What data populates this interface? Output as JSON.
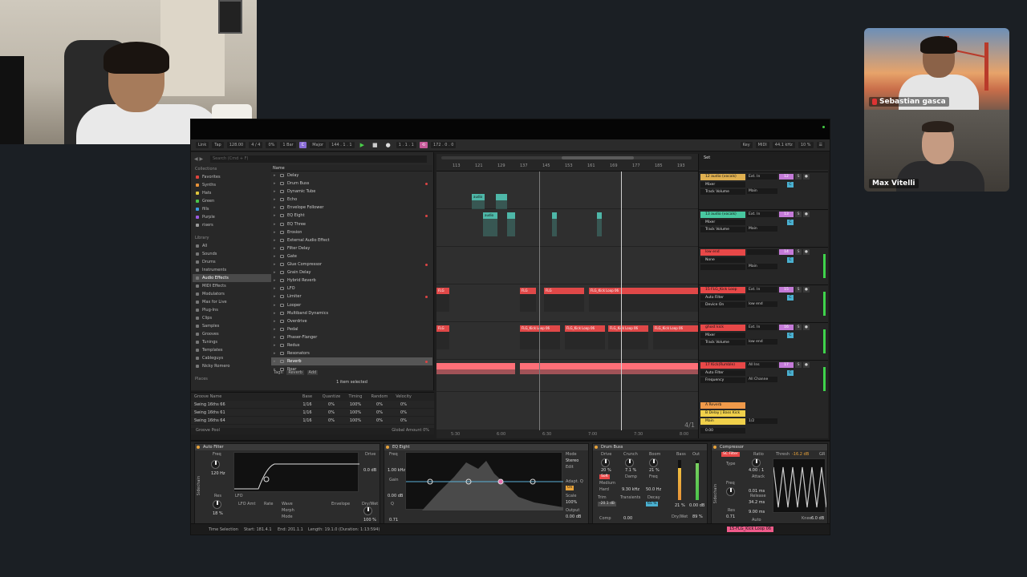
{
  "participants": [
    {
      "name": "Sebastian gasca",
      "muted": true
    },
    {
      "name": "Max Vitelli"
    }
  ],
  "toolbar": {
    "link": "Link",
    "tap": "Tap",
    "tempo": "128.00",
    "meter": "4 / 4",
    "cpu_pct": "0%",
    "quantize": "1 Bar",
    "key": "C",
    "scale": "Major",
    "position": "144 .  1 .  1",
    "loop_start": "1 .  1 .  1",
    "loop_len": "172 .  0 .  0",
    "key_label": "Key",
    "midi_label": "MIDI",
    "sample_rate": "44.1 kHz",
    "cpu_load": "10 %"
  },
  "browser": {
    "search_placeholder": "Search (Cmd + F)",
    "collections_header": "Collections",
    "collections": [
      {
        "label": "Favorites",
        "color": "#e0443c"
      },
      {
        "label": "Synths",
        "color": "#e89238"
      },
      {
        "label": "Hats",
        "color": "#e0c43c"
      },
      {
        "label": "Green",
        "color": "#4ac44a"
      },
      {
        "label": "fills",
        "color": "#3c9ae0"
      },
      {
        "label": "Purple",
        "color": "#9a5ae0"
      },
      {
        "label": "risers",
        "color": "#999999"
      }
    ],
    "library_header": "Library",
    "library": [
      "All",
      "Sounds",
      "Drums",
      "Instruments",
      "Audio Effects",
      "MIDI Effects",
      "Modulators",
      "Max for Live",
      "Plug-Ins",
      "Clips",
      "Samples",
      "Grooves",
      "Tunings",
      "Templates",
      "Cableguys",
      "Nicky Romero"
    ],
    "library_selected": 4,
    "places_header": "Places",
    "name_header": "Name",
    "files": [
      "Delay",
      "Drum Buss",
      "Dynamic Tube",
      "Echo",
      "Envelope Follower",
      "EQ Eight",
      "EQ Three",
      "Erosion",
      "External Audio Effect",
      "Filter Delay",
      "Gate",
      "Glue Compressor",
      "Grain Delay",
      "Hybrid Reverb",
      "LFO",
      "Limiter",
      "Looper",
      "Multiband Dynamics",
      "Overdrive",
      "Pedal",
      "Phaser-Flanger",
      "Redux",
      "Resonators",
      "Reverb",
      "Roar"
    ],
    "file_marks": [
      1,
      5,
      11,
      15,
      23
    ],
    "file_selected": 23,
    "tags_label": "Tags:",
    "tag_value": "Reverb",
    "tag_add": "Add",
    "selection_info": "1 item selected"
  },
  "groove_pool": {
    "headers": [
      "Groove Name",
      "Base",
      "Quantize",
      "Timing",
      "Random",
      "Velocity"
    ],
    "rows": [
      [
        "Swing 16ths 66",
        "1/16",
        "0%",
        "100%",
        "0%",
        "0%"
      ],
      [
        "Swing 16ths 61",
        "1/16",
        "0%",
        "100%",
        "0%",
        "0%"
      ],
      [
        "Swing 16ths 64",
        "1/16",
        "0%",
        "100%",
        "0%",
        "0%"
      ]
    ],
    "footer_left": "Groove Pool",
    "global_amount_label": "Global Amount",
    "global_amount": "0%"
  },
  "arrangement": {
    "bars": [
      "113",
      "121",
      "129",
      "137",
      "145",
      "153",
      "161",
      "169",
      "177",
      "185",
      "193"
    ],
    "times": [
      "5:30",
      "6:00",
      "6:30",
      "7:00",
      "7:30",
      "8:00"
    ],
    "zoom": "4/1",
    "clips": {
      "audio": "audio",
      "kick_loop": "FLG_Kick Loop 06",
      "flg": "FLG"
    }
  },
  "mixer": {
    "set_label": "Set",
    "tracks": [
      {
        "name": "12 audio (vocals)",
        "color": "#e0b050",
        "num": "12",
        "input": "Ext. In",
        "sel": "Mixer",
        "sel2": "Track Volume",
        "out": "Main"
      },
      {
        "name": "13 audio (vocals)",
        "color": "#48c8a0",
        "num": "13",
        "input": "Ext. In",
        "sel": "Mixer",
        "sel2": "Track Volume",
        "out": "Main"
      },
      {
        "name": "low end",
        "color": "#e84848",
        "num": "14",
        "input": "",
        "sel": "None",
        "sel2": "",
        "out": "Main"
      },
      {
        "name": "15 FLG_Kick Loop",
        "color": "#e84848",
        "num": "15",
        "input": "Ext. In",
        "sel": "Auto Filter",
        "sel2": "Device On",
        "out": "low end"
      },
      {
        "name": "ghost kick",
        "color": "#e84848",
        "num": "16",
        "input": "Ext. In",
        "sel": "Mixer",
        "sel2": "Track Volume",
        "out": "low end"
      },
      {
        "name": "17 Kick(Rumble)",
        "color": "#e84848",
        "num": "17",
        "input": "All Ins",
        "sel": "Auto Filter",
        "sel2": "Frequency",
        "out": "All Channe"
      }
    ],
    "returns": [
      {
        "label": "A Reverb",
        "color": "#f09a4a"
      },
      {
        "label": "B Delay | Bass Kick",
        "color": "#f0d04a"
      },
      {
        "label": "Main",
        "color": "#f0d04a"
      }
    ],
    "fraction": "1/2",
    "zoom_val": "0.00"
  },
  "devices": {
    "auto_filter": {
      "title": "Auto Filter",
      "freq_label": "Freq",
      "freq": "120 Hz",
      "res_label": "Res",
      "res": "18 %",
      "lfo": "LFO",
      "lfo_amt": "LFO Amt",
      "rate": "Rate",
      "wave": "Wave",
      "morph": "Morph",
      "mode": "Mode",
      "envelope": "Envelope",
      "drive": "Drive",
      "drive_val": "0.0 dB",
      "dry_wet": "Dry/Wet",
      "dry_wet_val": "100 %",
      "sidechain": "Sidechain"
    },
    "eq_eight": {
      "title": "EQ Eight",
      "freq": "Freq",
      "freq_val": "1.00 kHz",
      "gain": "Gain",
      "gain_val": "0.00 dB",
      "q": "Q",
      "q_val": "0.71",
      "mode": "Mode",
      "mode_val": "Stereo",
      "edit": "Edit",
      "adapt_q": "Adapt. Q",
      "adapt_on": "On",
      "scale": "Scale",
      "scale_val": "100%",
      "output": "Output",
      "output_val": "0.00 dB"
    },
    "drum_buss": {
      "title": "Drum Buss",
      "drive": "Drive",
      "drive_val": "20 %",
      "crunch": "Crunch",
      "crunch_val": "7.1 %",
      "boom": "Boom",
      "boom_val": "21 %",
      "soft": "Soft",
      "medium": "Medium",
      "hard": "Hard",
      "damp": "Damp",
      "damp_val": "9.30 kHz",
      "freq": "Freq",
      "freq_val": "50.0 Hz",
      "trim": "Trim",
      "trim_val": "-20.1 dB",
      "transients": "Transients",
      "transients_val": "0.00",
      "decay": "Decay",
      "decay_val": "65 %",
      "comp": "Comp",
      "bass": "Bass",
      "out": "Out",
      "bass_val": "21 %",
      "out_val": "0.00 dB",
      "dry_wet": "Dry/Wet",
      "dry_wet_val": "89 %"
    },
    "compressor": {
      "title": "Compressor",
      "sc": "SC Filter",
      "type": "Type",
      "freq": "Freq",
      "res": "Res",
      "res_val": "0.71",
      "ratio": "Ratio",
      "ratio_val": "4.00 : 1",
      "attack": "Attack",
      "attack_val": "0.01 ms",
      "release": "Release",
      "release_val": "34.2 ms",
      "release2": "9.00 ms",
      "auto": "Auto",
      "thresh": "Thresh",
      "thresh_val": "-16.2 dB",
      "gr": "GR",
      "knee": "Knee",
      "knee_val": "6.0 dB",
      "sidechain": "Sidechain"
    }
  },
  "status_bar": {
    "mode": "Time Selection",
    "start": "Start: 181.4.1",
    "end": "End: 201.1.1",
    "length": "Length: 19.1.0  (Duration: 1:13:594)",
    "clip": "15-FLG_Kick Loop 06"
  }
}
